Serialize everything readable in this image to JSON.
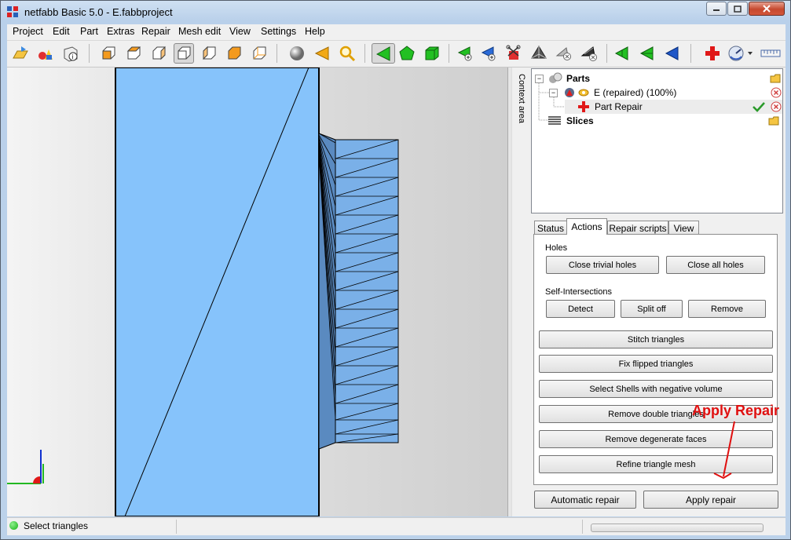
{
  "window": {
    "title": "netfabb Basic 5.0 - E.fabbproject"
  },
  "menu": [
    "Project",
    "Edit",
    "Part",
    "Extras",
    "Repair",
    "Mesh edit",
    "View",
    "Settings",
    "Help"
  ],
  "toolbar": {
    "icons": [
      "open-project-icon",
      "add-part-icon",
      "part-info-icon",
      "view-front-icon",
      "view-back-icon",
      "view-left-icon",
      "view-right-icon",
      "view-top-icon",
      "view-bottom-icon",
      "view-perspective-icon",
      "shaded-sphere-icon",
      "select-arrow-icon",
      "zoom-icon",
      "select-triangle-icon",
      "select-surface-icon",
      "select-shell-icon",
      "add-triangle-icon",
      "add-triangle-ext-icon",
      "cut-icon",
      "tetra-icon",
      "remove-triangle-icon",
      "remove-triangle-ext-icon",
      "flip-left-icon",
      "flip-right-icon",
      "flip-blue-icon",
      "repair-cross-icon",
      "gauge-icon",
      "ruler-icon"
    ]
  },
  "context_area_label": "Context area",
  "tree": {
    "parts_label": "Parts",
    "part_name": "E (repaired) (100%)",
    "part_repair_label": "Part Repair",
    "slices_label": "Slices"
  },
  "tabs": [
    "Status",
    "Actions",
    "Repair scripts",
    "View"
  ],
  "actions": {
    "holes_label": "Holes",
    "close_trivial_holes": "Close trivial holes",
    "close_all_holes": "Close all holes",
    "self_intersections_label": "Self-Intersections",
    "detect": "Detect",
    "split_off": "Split off",
    "remove": "Remove",
    "stitch_triangles": "Stitch triangles",
    "fix_flipped_triangles": "Fix flipped triangles",
    "select_shells_negative": "Select Shells with negative volume",
    "remove_double_triangles": "Remove double triangles",
    "remove_degenerate_faces": "Remove degenerate faces",
    "refine_triangle_mesh": "Refine triangle mesh"
  },
  "bottom_buttons": {
    "automatic_repair": "Automatic repair",
    "apply_repair": "Apply repair"
  },
  "annotation": "Apply Repair",
  "status": {
    "text": "Select triangles"
  }
}
